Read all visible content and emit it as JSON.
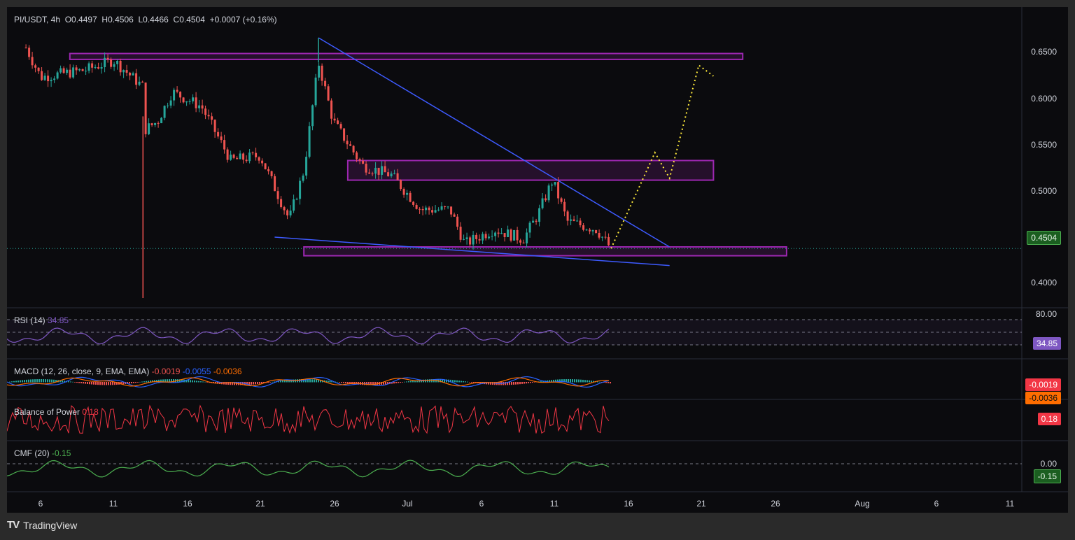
{
  "header": {
    "symbol": "PI/USDT, 4h",
    "open": "O0.4497",
    "high": "H0.4506",
    "low": "L0.4466",
    "close": "C0.4504",
    "change": "+0.0007 (+0.16%)"
  },
  "price_axis": {
    "ticks": [
      "0.6500",
      "0.6000",
      "0.5500",
      "0.5000",
      "0.4000"
    ],
    "current_price": "0.4504"
  },
  "time_axis": {
    "ticks": [
      "6",
      "11",
      "16",
      "21",
      "26",
      "Jul",
      "6",
      "11",
      "16",
      "21",
      "26",
      "Aug",
      "6",
      "11"
    ]
  },
  "indicators": {
    "rsi": {
      "label": "RSI (14)",
      "value": "34.85",
      "upper": "80.00",
      "tag": "34.85"
    },
    "macd": {
      "label": "MACD (12, 26, close, 9, EMA, EMA)",
      "v1": "-0.0019",
      "v2": "-0.0055",
      "v3": "-0.0036",
      "tag1": "-0.0019",
      "tag2": "-0.0036"
    },
    "bop": {
      "label": "Balance of Power",
      "value": "0.18",
      "tag": "0.18"
    },
    "cmf": {
      "label": "CMF (20)",
      "value": "-0.15",
      "zero": "0.00",
      "tag": "-0.15"
    }
  },
  "footer": {
    "brand": "TradingView"
  },
  "colors": {
    "up": "#26a69a",
    "down": "#ef5350",
    "zone": "#9c27b0",
    "trendline": "#3d5afe",
    "projection": "#ffeb3b",
    "rsi": "#7e57c2",
    "macd": "#2962ff",
    "signal": "#ff6d00",
    "bop": "#f23645",
    "cmf": "#4caf50"
  },
  "chart_data": {
    "type": "candlestick",
    "title": "PI/USDT, 4h",
    "ylim": [
      0.39,
      0.675
    ],
    "x": [
      "Jun 6",
      "Jun 11",
      "Jun 16",
      "Jun 21",
      "Jun 26",
      "Jul 1",
      "Jul 6",
      "Jul 11",
      "Jul 16",
      "Jul 21",
      "Jul 26",
      "Aug 1",
      "Aug 6",
      "Aug 11"
    ],
    "price_path": [
      [
        "Jun 5",
        0.655
      ],
      [
        "Jun 6",
        0.625
      ],
      [
        "Jun 9",
        0.632
      ],
      [
        "Jun 11",
        0.642
      ],
      [
        "Jun 13",
        0.615
      ],
      [
        "Jun 13",
        0.57
      ],
      [
        "Jun 14",
        0.58
      ],
      [
        "Jun 15",
        0.61
      ],
      [
        "Jun 17",
        0.595
      ],
      [
        "Jun 19",
        0.54
      ],
      [
        "Jun 21",
        0.545
      ],
      [
        "Jun 23",
        0.48
      ],
      [
        "Jun 24",
        0.53
      ],
      [
        "Jun 25",
        0.64
      ],
      [
        "Jun 26",
        0.58
      ],
      [
        "Jun 28",
        0.535
      ],
      [
        "Jun 30",
        0.525
      ],
      [
        "Jul 2",
        0.49
      ],
      [
        "Jul 4",
        0.49
      ],
      [
        "Jul 5",
        0.455
      ],
      [
        "Jul 7",
        0.47
      ],
      [
        "Jul 9",
        0.46
      ],
      [
        "Jul 10",
        0.485
      ],
      [
        "Jul 11",
        0.52
      ],
      [
        "Jul 12",
        0.478
      ],
      [
        "Jul 14",
        0.47
      ],
      [
        "Jul 15",
        0.4504
      ]
    ],
    "wick_low": 0.4,
    "wick_high": 0.665,
    "zones": [
      {
        "from": "Jun 8",
        "to": "Jul 24",
        "low": 0.643,
        "high": 0.649
      },
      {
        "from": "Jun 27",
        "to": "Jul 22",
        "low": 0.52,
        "high": 0.54
      },
      {
        "from": "Jun 24",
        "to": "Jul 27",
        "low": 0.443,
        "high": 0.452
      }
    ],
    "trendlines": [
      {
        "from": [
          "Jun 25",
          0.665
        ],
        "to": [
          "Jul 19",
          0.452
        ]
      },
      {
        "from": [
          "Jun 22",
          0.462
        ],
        "to": [
          "Jul 19",
          0.433
        ]
      }
    ],
    "projection": [
      [
        "Jul 15",
        0.4504
      ],
      [
        "Jul 18",
        0.548
      ],
      [
        "Jul 19",
        0.522
      ],
      [
        "Jul 21",
        0.637
      ],
      [
        "Jul 22",
        0.626
      ]
    ],
    "current_price": 0.4504,
    "rsi": {
      "value": 34.85
    },
    "macd": {
      "macd": -0.0019,
      "signal": -0.0055,
      "hist": -0.0036
    },
    "bop": {
      "value": 0.18
    },
    "cmf": {
      "value": -0.15
    }
  }
}
